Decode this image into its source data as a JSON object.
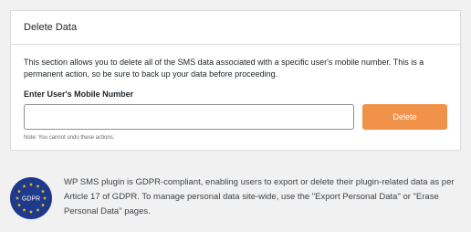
{
  "panel": {
    "title": "Delete Data",
    "description": "This section allows you to delete all of the SMS data associated with a specific user's mobile number. This is a permanent action, so be sure to back up your data before proceeding.",
    "field_label": "Enter User's Mobile Number",
    "input_value": "",
    "input_placeholder": "",
    "delete_label": "Delete",
    "note": "Note: You cannot undo these actions."
  },
  "gdpr": {
    "badge_text": "GDPR",
    "badge_icon": "eu-stars-badge",
    "text": "WP SMS plugin is GDPR-compliant, enabling users to export or delete their plugin-related data as per Article 17 of GDPR. To manage personal data site-wide, use the \"Export Personal Data\" or \"Erase Personal Data\" pages."
  },
  "colors": {
    "accent": "#f0924a",
    "badge_blue": "#1f3a8a",
    "badge_star": "#f5c518"
  }
}
